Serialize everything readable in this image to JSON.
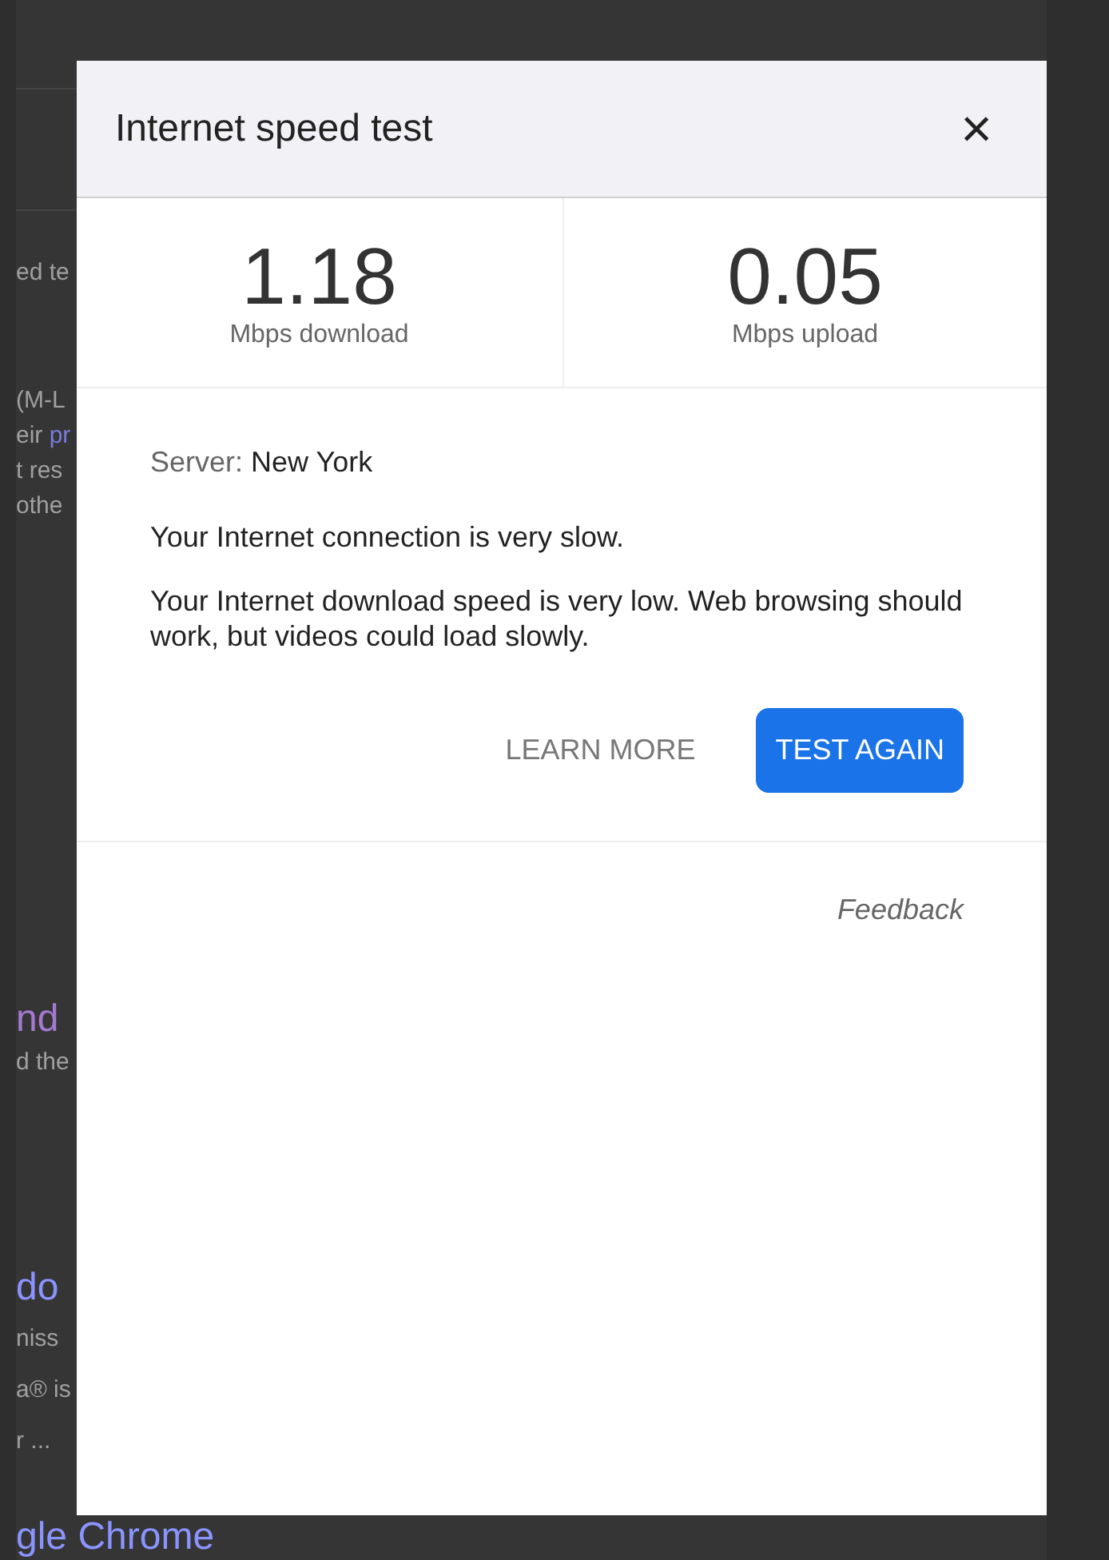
{
  "background_page": {
    "blocks": [
      {
        "lines": [
          [
            {
              "text": "ed te",
              "kind": "text"
            }
          ]
        ]
      },
      {
        "lines": [
          [
            {
              "text": "(M-L",
              "kind": "text"
            }
          ],
          [
            {
              "text": "eir ",
              "kind": "text"
            },
            {
              "text": "pr",
              "kind": "link"
            }
          ],
          [
            {
              "text": "t res",
              "kind": "text"
            }
          ],
          [
            {
              "text": "othe",
              "kind": "text"
            }
          ]
        ]
      },
      {
        "lines": [
          [
            {
              "text": "nd",
              "kind": "visited_title"
            }
          ],
          [
            {
              "text": "d the",
              "kind": "text"
            }
          ]
        ]
      },
      {
        "lines": [
          [
            {
              "text": "do",
              "kind": "link_title"
            }
          ],
          [
            {
              "text": "niss",
              "kind": "text"
            }
          ],
          [
            {
              "text": "a® is",
              "kind": "text"
            }
          ],
          [
            {
              "text": "r ...",
              "kind": "text"
            }
          ]
        ]
      }
    ],
    "bottom_title": "gle Chrome"
  },
  "dialog": {
    "title": "Internet speed test",
    "close": "×",
    "results": [
      {
        "value": "1.18",
        "label": "Mbps download"
      },
      {
        "value": "0.05",
        "label": "Mbps upload"
      }
    ],
    "server_label": "Server:",
    "server": "New York",
    "summary": "Your Internet connection is very slow.",
    "detail": "Your Internet download speed is very low. Web browsing should work, but videos could load slowly.",
    "buttons": [
      {
        "label": "LEARN MORE",
        "kind": "text"
      },
      {
        "label": "TEST AGAIN",
        "kind": "primary"
      }
    ],
    "feedback": "Feedback"
  }
}
